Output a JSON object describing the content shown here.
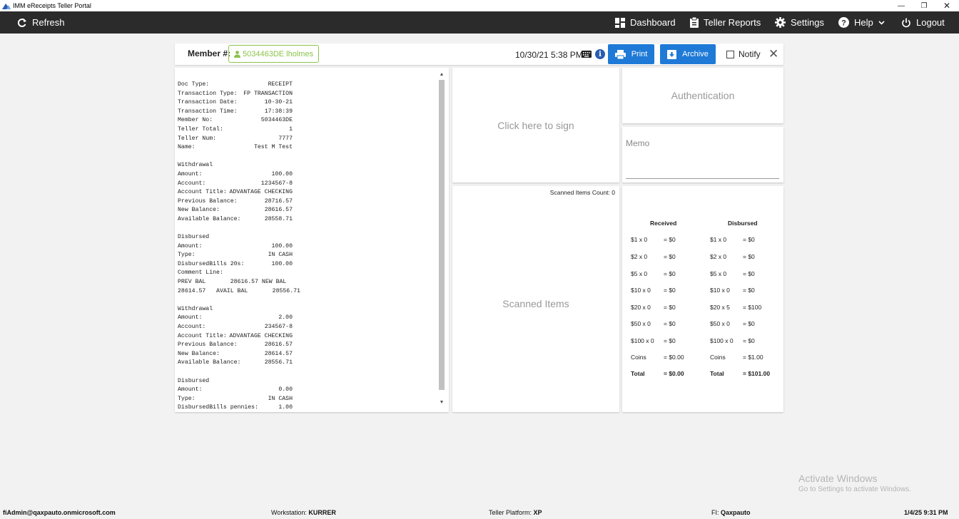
{
  "window": {
    "title": "IMM eReceipts Teller Portal"
  },
  "navbar": {
    "refresh": "Refresh",
    "dashboard": "Dashboard",
    "teller_reports": "Teller Reports",
    "settings": "Settings",
    "help": "Help",
    "logout": "Logout"
  },
  "memberbar": {
    "label": "Member #:",
    "member_value": "5034463DE lholmes",
    "datetime": "10/30/21 5:38 PM",
    "print": "Print",
    "archive": "Archive",
    "notify": "Notify",
    "colors": {
      "accent": "#1e7ad6",
      "member_green": "#8bc34a"
    }
  },
  "receipt": {
    "lines": [
      [
        "Doc Type:",
        "RECEIPT"
      ],
      [
        "Transaction Type:",
        "FP TRANSACTION"
      ],
      [
        "Transaction Date:",
        "10-30-21"
      ],
      [
        "Transaction Time:",
        "17:38:39"
      ],
      [
        "Member No:",
        "5034463DE"
      ],
      [
        "Teller Total:",
        "1"
      ],
      [
        "Teller Num:",
        "7777"
      ],
      [
        "Name:",
        "Test M Test"
      ],
      [
        "",
        ""
      ],
      [
        "Withdrawal",
        ""
      ],
      [
        "Amount:",
        "100.00"
      ],
      [
        "Account:",
        "1234567-8"
      ],
      [
        "Account Title:",
        "ADVANTAGE CHECKING"
      ],
      [
        "Previous Balance:",
        "28716.57"
      ],
      [
        "New Balance:",
        "28616.57"
      ],
      [
        "Available Balance:",
        "28558.71"
      ],
      [
        "",
        ""
      ],
      [
        "Disbursed",
        ""
      ],
      [
        "Amount:",
        "100.00"
      ],
      [
        "Type:",
        "IN CASH"
      ],
      [
        "DisbursedBills 20s:",
        "100.00"
      ],
      [
        "Comment Line:",
        ""
      ],
      [
        "PREV BAL       28616.57 NEW BAL",
        ""
      ],
      [
        "28614.57   AVAIL BAL       28556.71",
        ""
      ],
      [
        "",
        ""
      ],
      [
        "Withdrawal",
        ""
      ],
      [
        "Amount:",
        "2.00"
      ],
      [
        "Account:",
        "234567-8"
      ],
      [
        "Account Title:",
        "ADVANTAGE CHECKING"
      ],
      [
        "Previous Balance:",
        "28616.57"
      ],
      [
        "New Balance:",
        "28614.57"
      ],
      [
        "Available Balance:",
        "28556.71"
      ],
      [
        "",
        ""
      ],
      [
        "Disbursed",
        ""
      ],
      [
        "Amount:",
        "0.00"
      ],
      [
        "Type:",
        "IN CASH"
      ],
      [
        "DisbursedBills pennies:",
        "1.00"
      ]
    ]
  },
  "sign": {
    "label": "Click here to sign"
  },
  "authentication": {
    "label": "Authentication"
  },
  "memo": {
    "label": "Memo"
  },
  "scanned": {
    "count_label": "Scanned Items Count: 0",
    "title": "Scanned Items"
  },
  "cash": {
    "received_header": "Received",
    "disbursed_header": "Disbursed",
    "received": [
      [
        "$1 x 0",
        "= $0"
      ],
      [
        "$2 x 0",
        "= $0"
      ],
      [
        "$5 x 0",
        "= $0"
      ],
      [
        "$10 x 0",
        "= $0"
      ],
      [
        "$20 x 0",
        "= $0"
      ],
      [
        "$50 x 0",
        "= $0"
      ],
      [
        "$100 x 0",
        "= $0"
      ],
      [
        "Coins",
        "= $0.00"
      ],
      [
        "Total",
        "= $0.00"
      ]
    ],
    "disbursed": [
      [
        "$1 x 0",
        "= $0"
      ],
      [
        "$2 x 0",
        "= $0"
      ],
      [
        "$5 x 0",
        "= $0"
      ],
      [
        "$10 x 0",
        "= $0"
      ],
      [
        "$20 x 5",
        "= $100"
      ],
      [
        "$50 x 0",
        "= $0"
      ],
      [
        "$100 x 0",
        "= $0"
      ],
      [
        "Coins",
        "= $1.00"
      ],
      [
        "Total",
        "= $101.00"
      ]
    ]
  },
  "watermark": {
    "line1": "Activate Windows",
    "line2": "Go to Settings to activate Windows."
  },
  "statusbar": {
    "user": "fiAdmin@qaxpauto.onmicrosoft.com",
    "workstation_label": "Workstation:",
    "workstation": "KURRER",
    "platform_label": "Teller Platform:",
    "platform": "XP",
    "fi_label": "FI:",
    "fi": "Qaxpauto",
    "datetime": "1/4/25 9:31 PM"
  }
}
